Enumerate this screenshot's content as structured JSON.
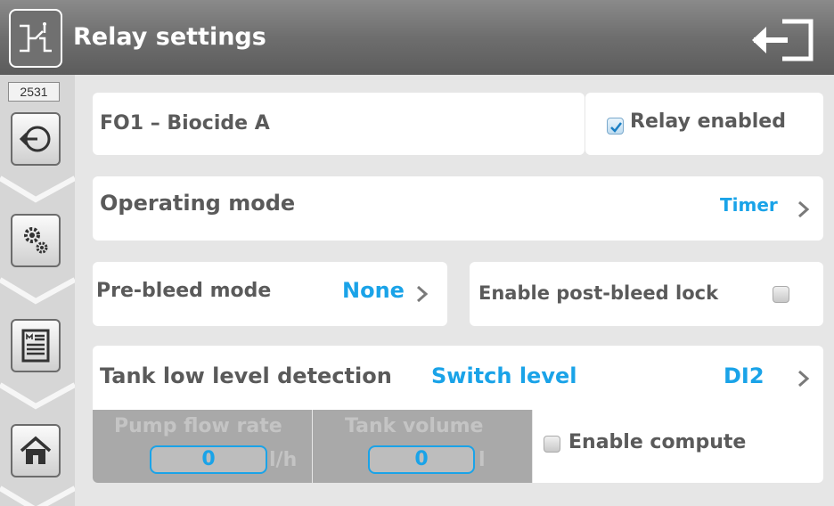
{
  "header": {
    "title": "Relay settings",
    "icon": "relay-icon",
    "exit_icon": "exit-icon"
  },
  "sidebar": {
    "id": "2531",
    "items": [
      {
        "name": "back",
        "icon": "back-arrow-icon"
      },
      {
        "name": "settings",
        "icon": "gears-icon"
      },
      {
        "name": "menu",
        "icon": "menu-list-icon"
      },
      {
        "name": "home",
        "icon": "home-icon"
      }
    ]
  },
  "relay": {
    "name": "FO1 – Biocide A",
    "enabled_label": "Relay enabled",
    "enabled": true
  },
  "operating_mode": {
    "label": "Operating mode",
    "value": "Timer"
  },
  "pre_bleed": {
    "label": "Pre-bleed mode",
    "value": "None"
  },
  "post_bleed": {
    "label": "Enable post-bleed lock",
    "checked": false
  },
  "tank_low": {
    "label": "Tank low level detection",
    "type": "Switch level",
    "input": "DI2"
  },
  "pump_flow": {
    "label": "Pump flow rate",
    "value": "0",
    "unit": "l/h"
  },
  "tank_volume": {
    "label": "Tank volume",
    "value": "0",
    "unit": "l"
  },
  "compute": {
    "label": "Enable compute",
    "checked": false
  },
  "colors": {
    "accent": "#1aa3e8",
    "label": "#5a5a5a",
    "header": "#6e6e6e"
  }
}
